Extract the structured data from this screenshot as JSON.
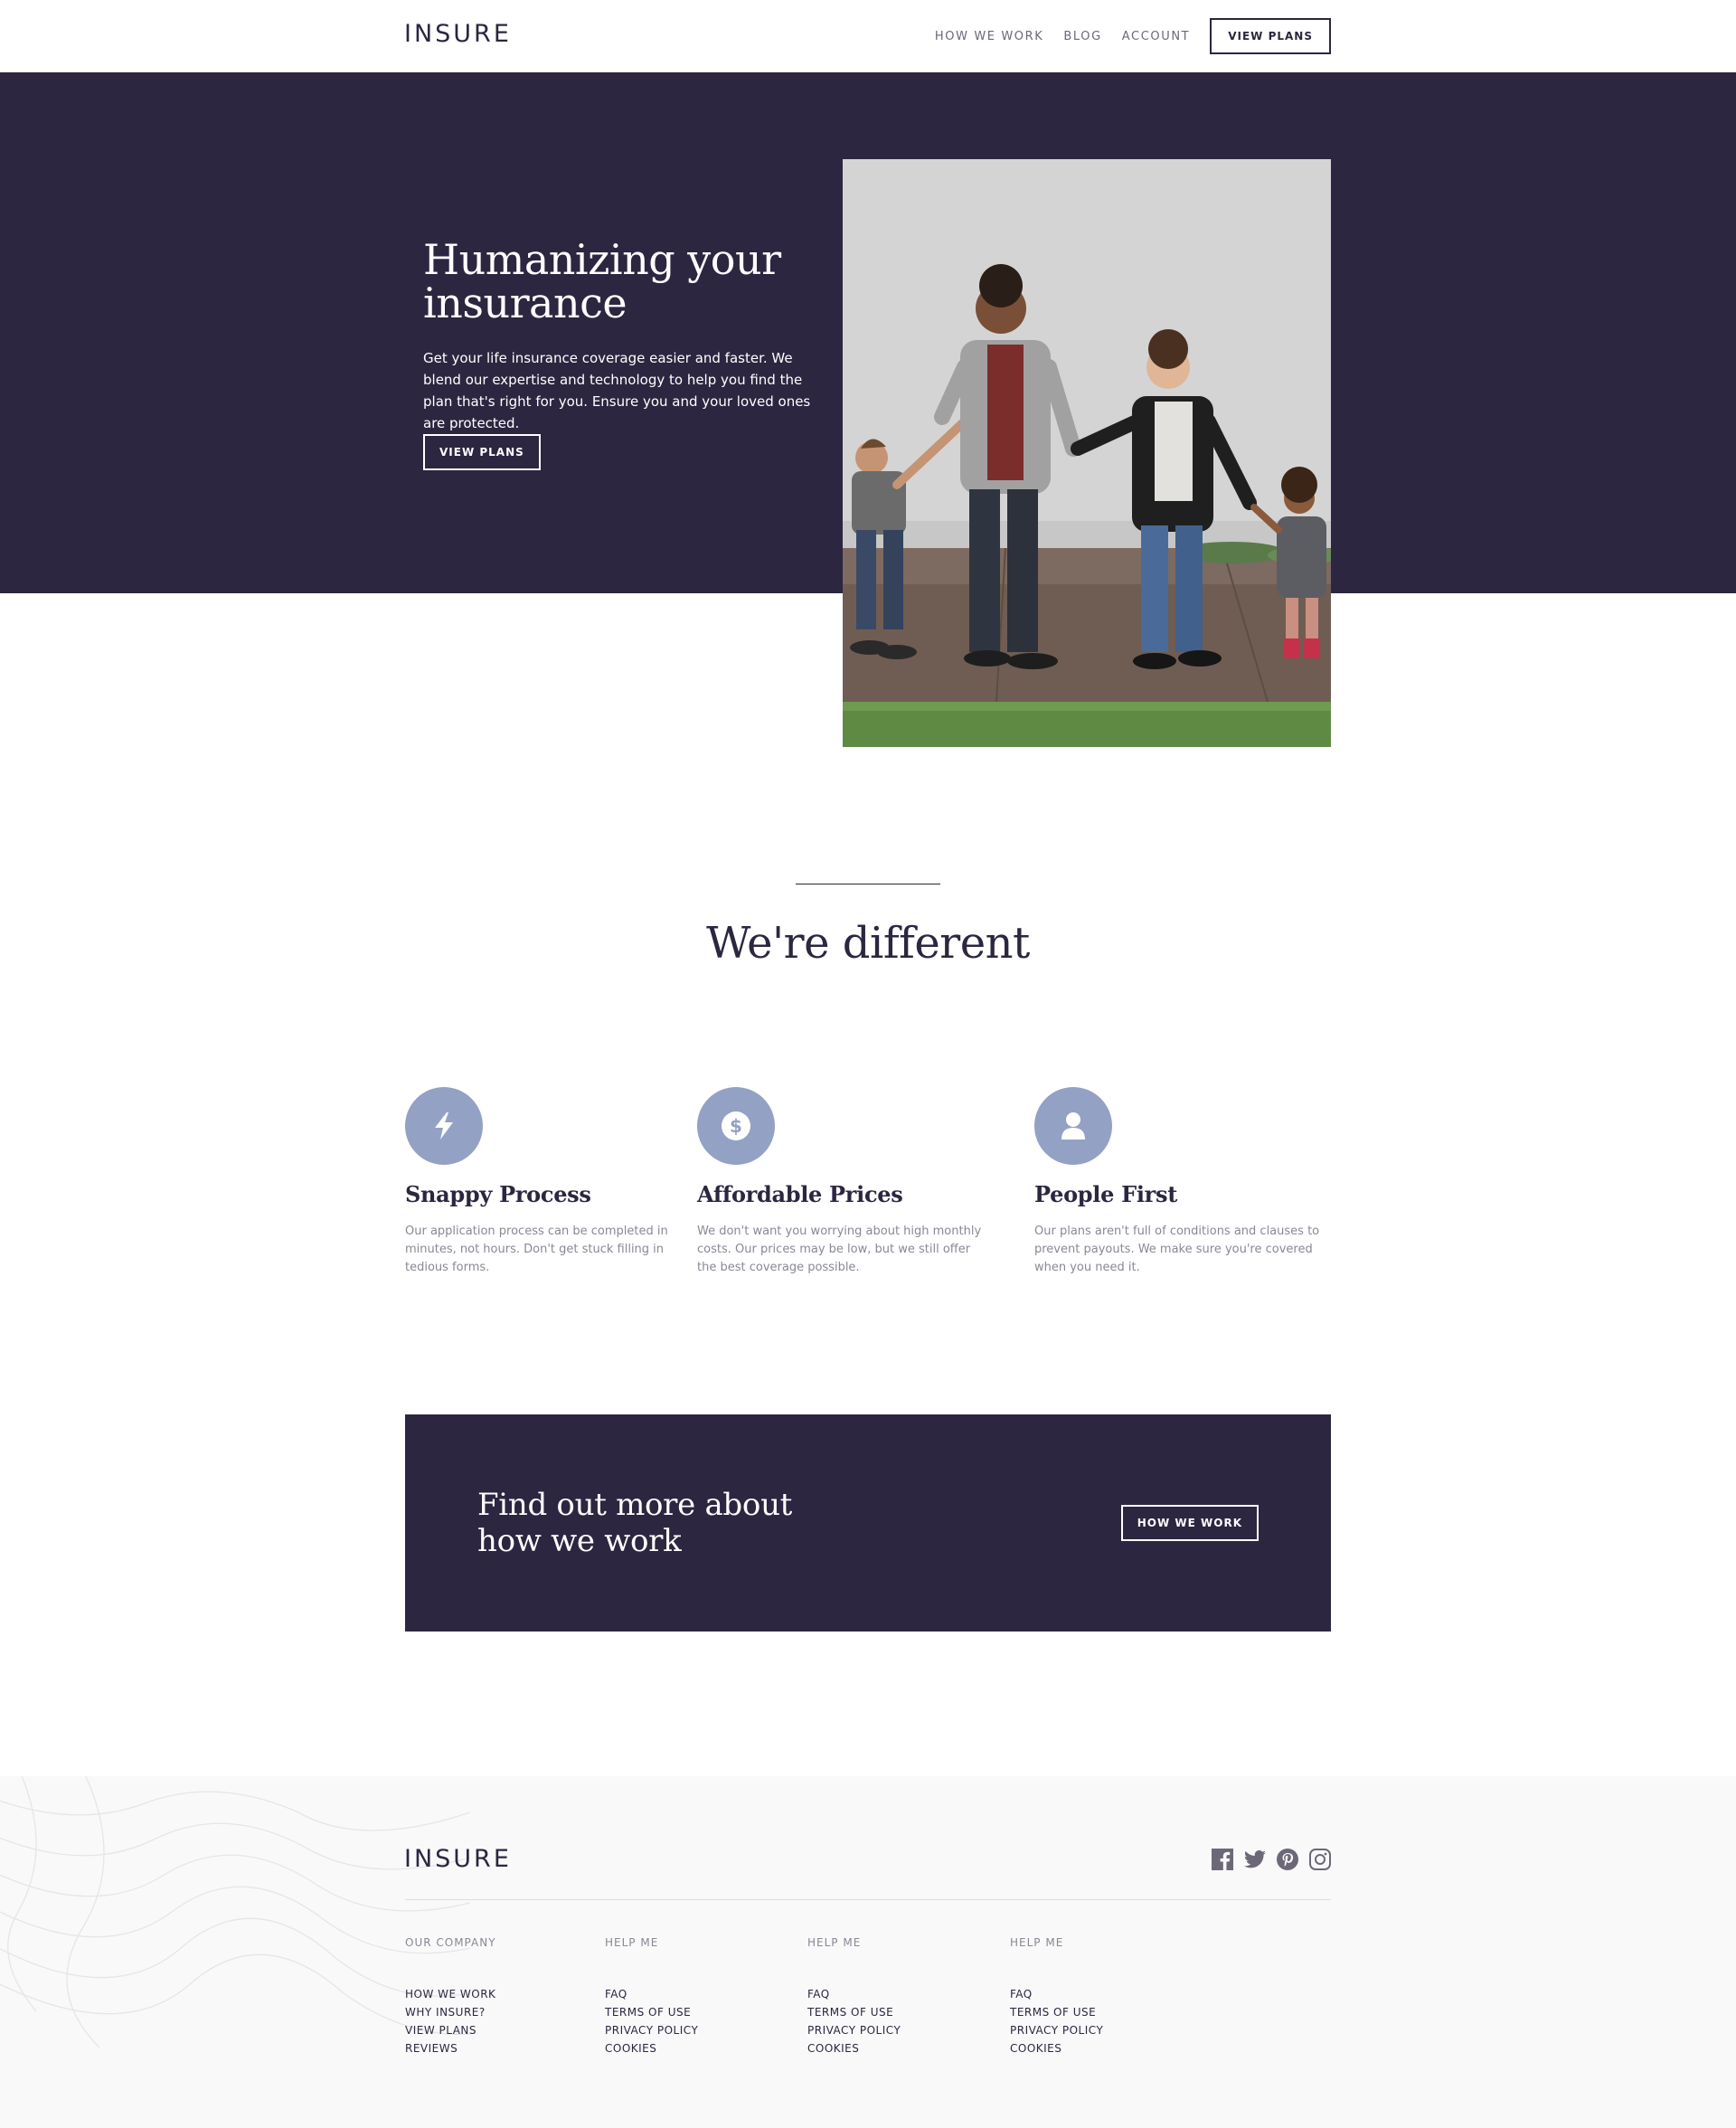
{
  "header": {
    "logo": "INSURE",
    "nav": [
      "HOW WE WORK",
      "BLOG",
      "ACCOUNT"
    ],
    "cta_label": "VIEW PLANS"
  },
  "hero": {
    "title": "Humanizing your insurance",
    "text": "Get your life insurance coverage easier and faster. We blend our expertise and technology to help you find the plan that's right for you. Ensure you and your loved ones are protected.",
    "button_label": "VIEW PLANS"
  },
  "different": {
    "title": "We're different",
    "features": [
      {
        "icon": "snappy-process-icon",
        "title": "Snappy Process",
        "text": "Our application process can be completed in minutes, not hours. Don't get stuck filling in tedious forms."
      },
      {
        "icon": "affordable-prices-icon",
        "title": "Affordable Prices",
        "text": "We don't want you worrying about high monthly costs. Our prices may be low, but we still offer the best coverage possible."
      },
      {
        "icon": "people-first-icon",
        "title": "People First",
        "text": "Our plans aren't full of conditions and clauses to prevent payouts. We make sure you're covered when you need it."
      }
    ]
  },
  "cta": {
    "title": "Find out more about how we work",
    "button_label": "HOW WE WORK"
  },
  "footer": {
    "logo": "INSURE",
    "socials": [
      "facebook-icon",
      "twitter-icon",
      "pinterest-icon",
      "instagram-icon"
    ],
    "columns": [
      {
        "heading": "OUR COMPANY",
        "links": [
          "HOW WE WORK",
          "WHY INSURE?",
          "VIEW PLANS",
          "REVIEWS"
        ]
      },
      {
        "heading": "HELP ME",
        "links": [
          "FAQ",
          "TERMS OF USE",
          "PRIVACY POLICY",
          "COOKIES"
        ]
      },
      {
        "heading": "HELP ME",
        "links": [
          "FAQ",
          "TERMS OF USE",
          "PRIVACY POLICY",
          "COOKIES"
        ]
      },
      {
        "heading": "HELP ME",
        "links": [
          "FAQ",
          "TERMS OF USE",
          "PRIVACY POLICY",
          "COOKIES"
        ]
      }
    ]
  },
  "colors": {
    "dark_violet": "#2c2640",
    "grayish_violet": "#93a1c4",
    "light_gray": "#f9f9f9",
    "white": "#ffffff"
  }
}
